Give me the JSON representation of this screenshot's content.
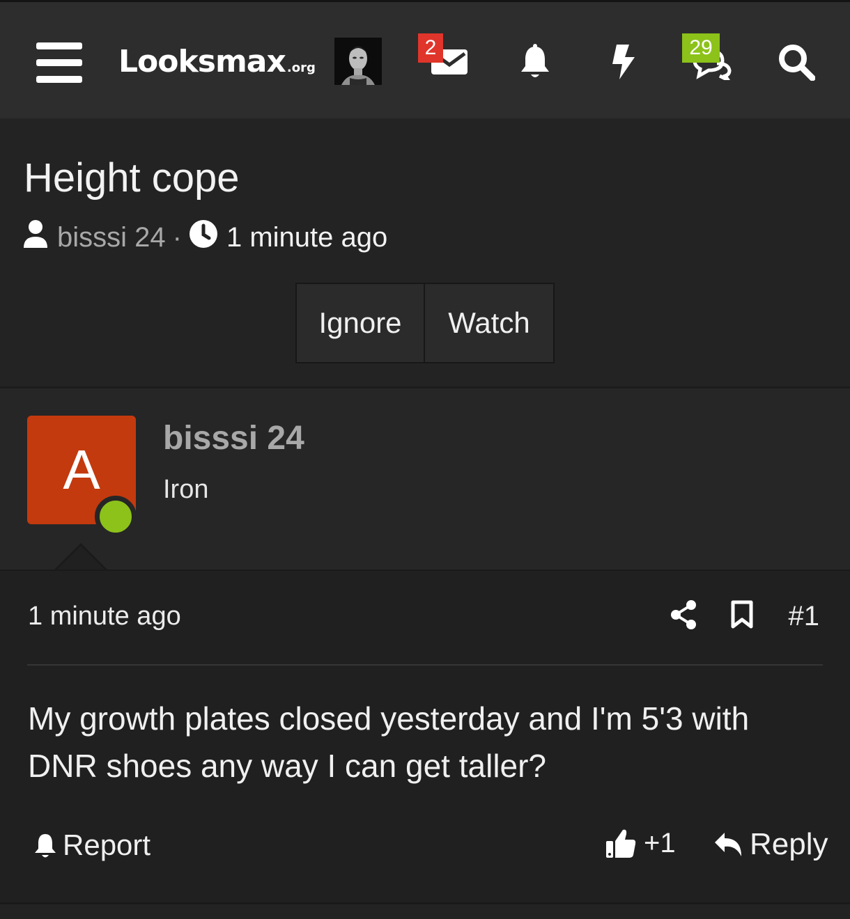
{
  "nav": {
    "logo_main": "Looksmax",
    "logo_suffix": ".org",
    "inbox_badge": "2",
    "chat_badge": "29"
  },
  "thread": {
    "title": "Height cope",
    "author": "bisssi 24",
    "separator": "·",
    "time": "1 minute ago",
    "ignore_label": "Ignore",
    "watch_label": "Watch"
  },
  "post": {
    "avatar_letter": "A",
    "username": "bisssi 24",
    "user_title": "Iron",
    "time": "1 minute ago",
    "post_number": "#1",
    "message": "My growth plates closed yesterday and I'm 5'3 with DNR shoes any way I can get taller?",
    "report_label": "Report",
    "like_count": "+1",
    "reply_label": "Reply"
  },
  "colors": {
    "nav_background": "#2d2d2d",
    "page_background": "#232323",
    "avatar_orange": "#c33a0e",
    "online_green": "#8cc21a",
    "badge_red": "#e0352b",
    "badge_green": "#8cc21a"
  }
}
